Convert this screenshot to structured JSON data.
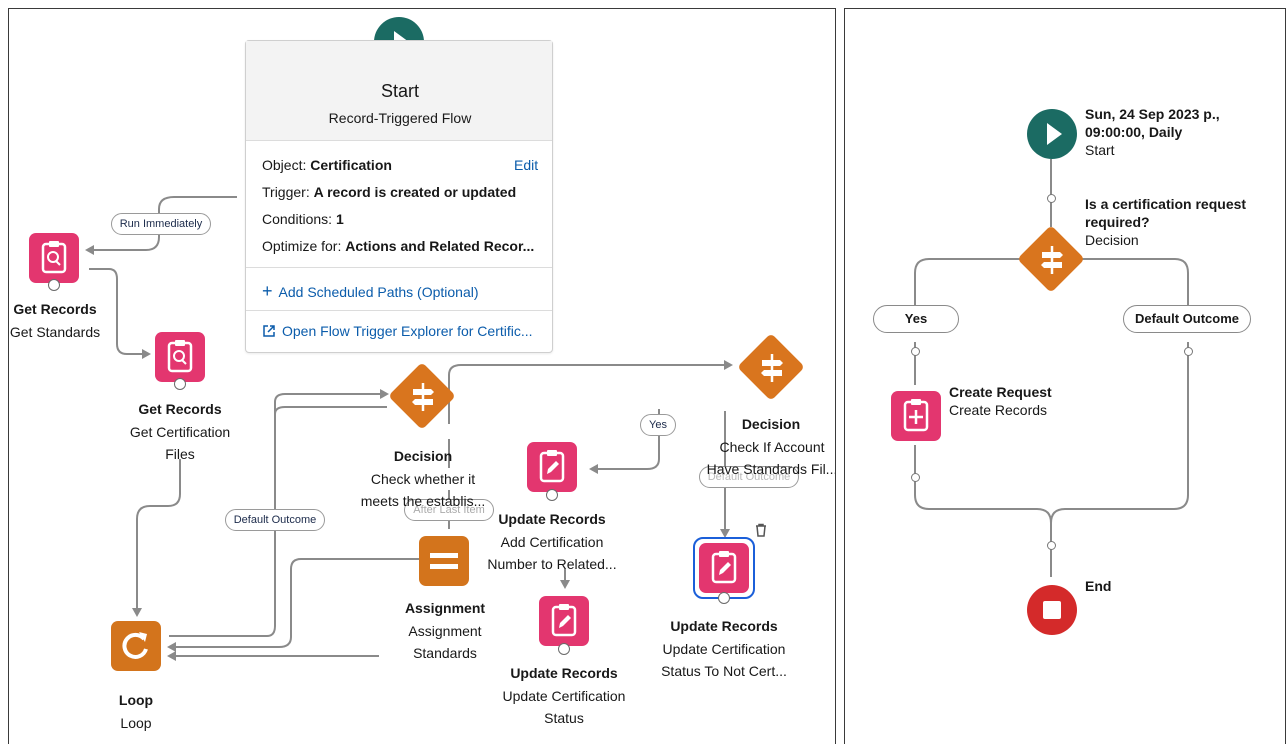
{
  "left": {
    "start": {
      "title": "Start",
      "subtitle": "Record-Triggered Flow",
      "object_label": "Object:",
      "object_value": "Certification",
      "edit_label": "Edit",
      "trigger_label": "Trigger:",
      "trigger_value": "A record is created or updated",
      "conditions_label": "Conditions:",
      "conditions_value": "1",
      "optimize_label": "Optimize for:",
      "optimize_value": "Actions and Related Recor...",
      "add_scheduled": "Add Scheduled Paths (Optional)",
      "open_explorer": "Open Flow Trigger Explorer for Certific..."
    },
    "pills": {
      "run_immediately": "Run Immediately",
      "default_outcome": "Default Outcome",
      "yes": "Yes",
      "after_last_item": "After Last Item",
      "default_outcome_2": "Default Outcome"
    },
    "nodes": {
      "get_standards": {
        "type": "Get Records",
        "name": "Get Standards"
      },
      "get_cert_files": {
        "type": "Get Records",
        "name_line1": "Get Certification",
        "name_line2": "Files"
      },
      "decision1": {
        "type": "Decision",
        "name_line1": "Check whether it",
        "name_line2": "meets the establis..."
      },
      "decision2": {
        "type": "Decision",
        "name_line1": "Check If Account",
        "name_line2": "Have Standards Fil..."
      },
      "update_add": {
        "type": "Update Records",
        "name_line1": "Add Certification",
        "name_line2": "Number to Related..."
      },
      "assignment": {
        "type": "Assignment",
        "name_line1": "Assignment",
        "name_line2": "Standards"
      },
      "update_status": {
        "type": "Update Records",
        "name_line1": "Update Certification",
        "name_line2": "Status"
      },
      "update_not_cert": {
        "type": "Update Records",
        "name_line1": "Update Certification",
        "name_line2": "Status To Not Cert..."
      },
      "loop": {
        "type": "Loop",
        "name": "Loop"
      }
    }
  },
  "right": {
    "start": {
      "line1": "Sun, 24 Sep 2023 p.,",
      "line2": "09:00:00, Daily",
      "type": "Start"
    },
    "decision": {
      "line1": "Is a certification request",
      "line2": "required?",
      "type": "Decision"
    },
    "pills": {
      "yes": "Yes",
      "default_outcome": "Default Outcome"
    },
    "create": {
      "name": "Create Request",
      "type": "Create Records"
    },
    "end": {
      "label": "End"
    }
  },
  "colors": {
    "start_green": "#1b6b63",
    "record_pink": "#e3366f",
    "logic_orange": "#d9751e",
    "end_red": "#d42a2a",
    "link_blue": "#0b5cab",
    "selected_ring": "#1b5fd9"
  },
  "icons": [
    "play-icon",
    "search-clipboard-icon",
    "edit-clipboard-icon",
    "add-clipboard-icon",
    "signpost-icon",
    "equals-icon",
    "loop-icon",
    "stop-icon",
    "plus-icon",
    "external-link-icon",
    "trash-icon"
  ]
}
